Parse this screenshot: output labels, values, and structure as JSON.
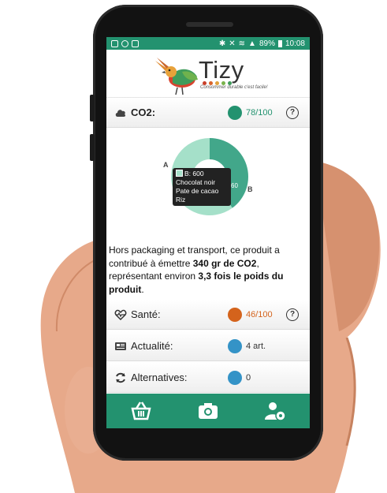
{
  "status_bar": {
    "battery": "89%",
    "time": "10:08"
  },
  "header": {
    "logo_text": "Tizy",
    "tagline": "Consommer durable c'est facile!"
  },
  "co2_row": {
    "label": "CO2:",
    "score": "78/100",
    "help": "?"
  },
  "chart": {
    "labels": [
      "A",
      "B"
    ],
    "tooltip_lines": [
      "B: 600",
      "Chocolat noir",
      "Pate de cacao",
      "Riz"
    ],
    "hidden_value": "60",
    "colors": {
      "A": "#42a78a",
      "B": "#a5e0c9"
    }
  },
  "chart_data": {
    "type": "pie",
    "categories": [
      "A",
      "B"
    ],
    "values": [
      400,
      600
    ],
    "title": "",
    "xlabel": "",
    "ylabel": ""
  },
  "info_text": {
    "part1": "Hors packaging et transport, ce produit a contribué à émettre ",
    "bold1": "340 gr de CO2",
    "part2": ", représentant environ ",
    "bold2": "3,3 fois le poids du produit",
    "part3": "."
  },
  "rows": [
    {
      "label": "Santé:",
      "value": "46/100",
      "help": "?"
    },
    {
      "label": "Actualité:",
      "value": "4 art."
    },
    {
      "label": "Alternatives:",
      "value": "0"
    }
  ],
  "colors": {
    "primary": "#23926f",
    "orange": "#d4631c",
    "blue": "#3493c7"
  },
  "tabs": [
    "basket-icon",
    "camera-icon",
    "user-settings-icon"
  ]
}
